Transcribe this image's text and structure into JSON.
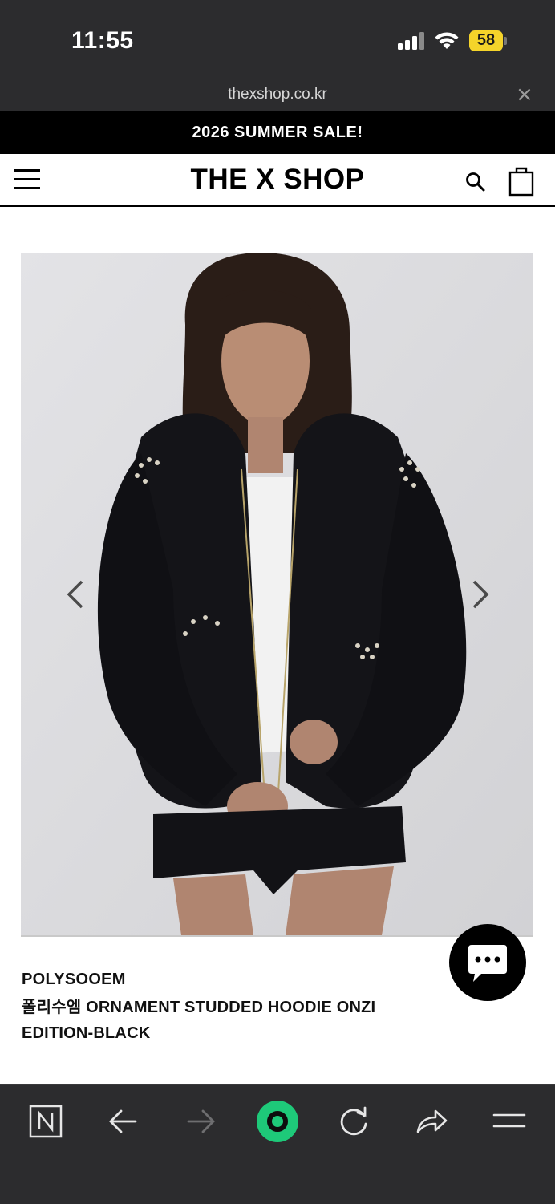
{
  "status_bar": {
    "time": "11:55",
    "battery_level": "58",
    "battery_color": "#f5d42a",
    "icons": [
      "signal-icon",
      "wifi-icon",
      "battery-icon"
    ]
  },
  "browser": {
    "url": "thexshop.co.kr",
    "close_glyph": "×",
    "toolbar_icons": [
      "naver-n-icon",
      "back-arrow-icon",
      "forward-arrow-icon",
      "green-circle-home-icon",
      "reload-icon",
      "share-icon",
      "menu-lines-icon"
    ]
  },
  "promo": {
    "text": "2026 SUMMER SALE!"
  },
  "header": {
    "logo": "THE X SHOP",
    "icons": [
      "hamburger-menu-icon",
      "search-icon",
      "shopping-bag-icon"
    ]
  },
  "product": {
    "brand": "POLYSOOEM",
    "name": "폴리수엠 ORNAMENT STUDDED HOODIE ONZI EDITION-BLACK",
    "carousel_icons": [
      "chevron-left-icon",
      "chevron-right-icon"
    ]
  },
  "chat": {
    "icon": "chat-bubble-icon"
  },
  "colors": {
    "chrome_dark": "#2c2c2e",
    "accent_green": "#1ec979",
    "promo_bg": "#000000"
  }
}
